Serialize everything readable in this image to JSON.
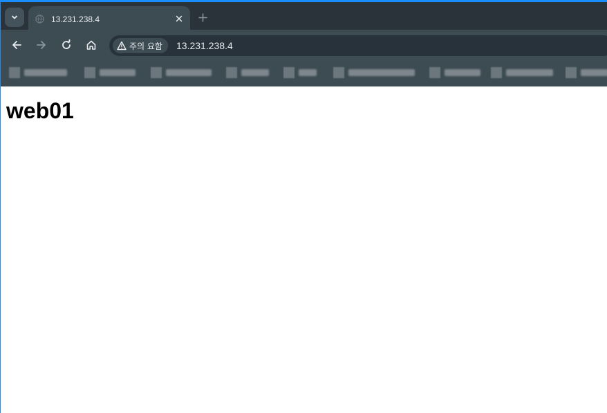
{
  "browser": {
    "tab": {
      "title": "13.231.238.4",
      "close_icon": "close-icon",
      "favicon_icon": "globe-icon"
    },
    "tab_search_icon": "chevron-down-icon",
    "new_tab_icon": "plus-icon",
    "nav": {
      "back_icon": "arrow-left-icon",
      "forward_icon": "arrow-right-icon",
      "reload_icon": "reload-icon",
      "home_icon": "home-icon"
    },
    "omnibox": {
      "security_icon": "warning-triangle-icon",
      "security_label": "주의 요함",
      "url": "13.231.238.4"
    },
    "bookmarks_note": "bookmark labels are blurred/unreadable in the screenshot"
  },
  "page": {
    "heading": "web01"
  },
  "colors": {
    "window_accent": "#1a8cff",
    "tabstrip_bg": "#2b333a",
    "toolbar_bg": "#3d4b53",
    "omnibox_bg": "#28323a",
    "content_bg": "#ffffff"
  }
}
